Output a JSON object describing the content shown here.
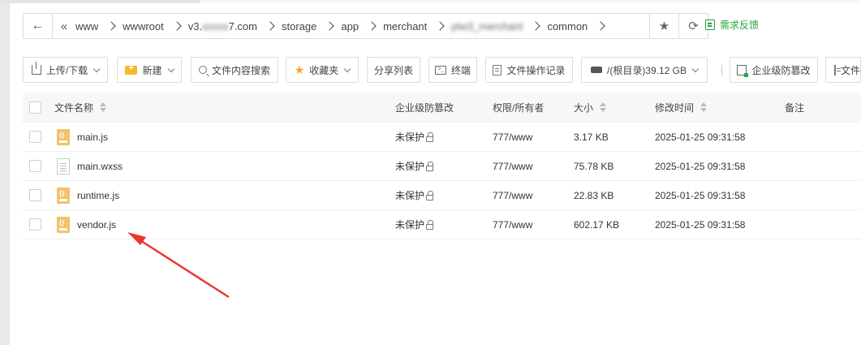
{
  "pathbar": {
    "back_icon": "arrow-left-icon",
    "lead_icon": "double-chevron-left-icon",
    "crumbs": [
      "www",
      "wwwroot",
      "v3.",
      "storage",
      "app",
      "merchant",
      "common"
    ],
    "domain_suffix": "7.com",
    "blurred_domain": "xxxxx",
    "blurred_folder": "plw3_merchant",
    "favorite_icon": "star-icon",
    "refresh_icon": "refresh-icon"
  },
  "feedback": {
    "label": "需求反馈",
    "icon": "feedback-icon",
    "color": "#20a53a"
  },
  "toolbar": {
    "upload": "上传/下载",
    "new": "新建",
    "content_search": "文件内容搜索",
    "favorites": "收藏夹",
    "share_list": "分享列表",
    "terminal": "终端",
    "operation_log": "文件操作记录",
    "disk": "/(根目录)39.12 GB",
    "tamper_proof": "企业级防篡改",
    "last_partial": "文件"
  },
  "table": {
    "headers": {
      "name": "文件名称",
      "protection": "企业级防篡改",
      "permission": "权限/所有者",
      "size": "大小",
      "modified": "修改时间",
      "note": "备注"
    },
    "rows": [
      {
        "name": "main.js",
        "type": "js",
        "protection": "未保护",
        "permission": "777/www",
        "size": "3.17 KB",
        "modified": "2025-01-25 09:31:58"
      },
      {
        "name": "main.wxss",
        "type": "txt",
        "protection": "未保护",
        "permission": "777/www",
        "size": "75.78 KB",
        "modified": "2025-01-25 09:31:58"
      },
      {
        "name": "runtime.js",
        "type": "js",
        "protection": "未保护",
        "permission": "777/www",
        "size": "22.83 KB",
        "modified": "2025-01-25 09:31:58"
      },
      {
        "name": "vendor.js",
        "type": "js",
        "protection": "未保护",
        "permission": "777/www",
        "size": "602.17 KB",
        "modified": "2025-01-25 09:31:58"
      }
    ]
  },
  "annotation": {
    "color": "#e8382f"
  }
}
